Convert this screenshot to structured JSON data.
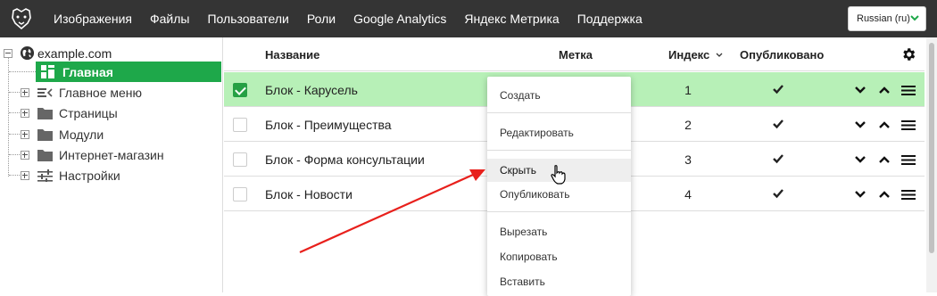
{
  "topbar": {
    "nav": [
      "Изображения",
      "Файлы",
      "Пользователи",
      "Роли",
      "Google Analytics",
      "Яндекс Метрика",
      "Поддержка"
    ],
    "language": "Russian (ru)",
    "colors": {
      "background": "#343434",
      "accent": "#1ea84a"
    }
  },
  "sidebar": {
    "root": "example.com",
    "active_item": "Главная",
    "items": [
      {
        "label": "Главное меню",
        "icon": "menu-list-icon"
      },
      {
        "label": "Страницы",
        "icon": "folder-icon"
      },
      {
        "label": "Модули",
        "icon": "folder-icon"
      },
      {
        "label": "Интернет-магазин",
        "icon": "folder-icon"
      },
      {
        "label": "Настройки",
        "icon": "sliders-icon"
      }
    ]
  },
  "table": {
    "headers": {
      "name": "Название",
      "tag": "Метка",
      "index": "Индекс",
      "published": "Опубликовано"
    },
    "rows": [
      {
        "name": "Блок - Карусель",
        "index": "1",
        "published": true,
        "selected": true
      },
      {
        "name": "Блок - Преимущества",
        "index": "2",
        "published": true,
        "selected": false
      },
      {
        "name": "Блок - Форма консультации",
        "index": "3",
        "published": true,
        "selected": false
      },
      {
        "name": "Блок - Новости",
        "index": "4",
        "published": true,
        "selected": false
      }
    ]
  },
  "context_menu": {
    "items": [
      "Создать",
      "Редактировать",
      "Скрыть",
      "Опубликовать",
      "Вырезать",
      "Копировать",
      "Вставить"
    ],
    "hovered": "Скрыть"
  }
}
